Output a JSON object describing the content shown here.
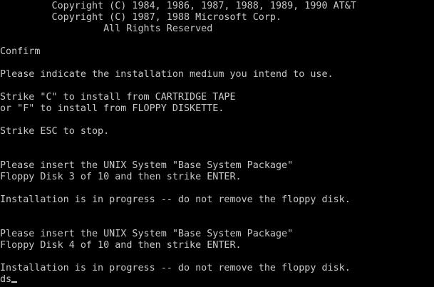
{
  "colors": {
    "background": "#000000",
    "text": "#c8c8c8"
  },
  "console": {
    "copyright_1": "         Copyright (C) 1984, 1986, 1987, 1988, 1989, 1990 AT&T",
    "copyright_2": "         Copyright (C) 1987, 1988 Microsoft Corp.",
    "rights": "                  All Rights Reserved",
    "confirm_title": "Confirm",
    "medium_prompt": "Please indicate the installation medium you intend to use.",
    "strike_c": "Strike \"C\" to install from CARTRIDGE TAPE",
    "strike_f": "or \"F\" to install from FLOPPY DISKETTE.",
    "strike_esc": "Strike ESC to stop.",
    "insert_disk3_line1": "Please insert the UNIX System \"Base System Package\"",
    "insert_disk3_line2": "Floppy Disk 3 of 10 and then strike ENTER.",
    "progress_1": "Installation is in progress -- do not remove the floppy disk.",
    "insert_disk4_line1": "Please insert the UNIX System \"Base System Package\"",
    "insert_disk4_line2": "Floppy Disk 4 of 10 and then strike ENTER.",
    "progress_2": "Installation is in progress -- do not remove the floppy disk.",
    "typed_input": "ds"
  }
}
